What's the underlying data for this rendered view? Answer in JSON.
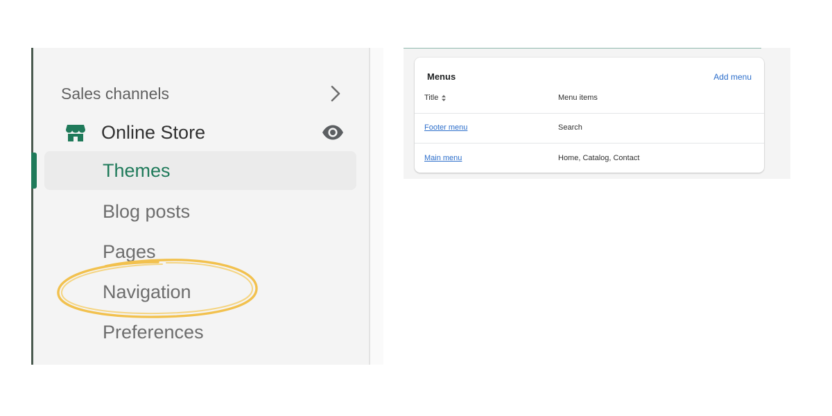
{
  "sidebar": {
    "section_label": "Sales channels",
    "store": {
      "label": "Online Store",
      "icon": "store-icon",
      "view_icon": "eye-icon"
    },
    "items": [
      {
        "label": "Themes",
        "active": true
      },
      {
        "label": "Blog posts",
        "active": false
      },
      {
        "label": "Pages",
        "active": false
      },
      {
        "label": "Navigation",
        "active": false,
        "highlighted": true
      },
      {
        "label": "Preferences",
        "active": false
      }
    ]
  },
  "menus_card": {
    "title": "Menus",
    "add_label": "Add menu",
    "columns": {
      "title": "Title",
      "items": "Menu items"
    },
    "rows": [
      {
        "title": "Footer menu",
        "items": "Search"
      },
      {
        "title": "Main menu",
        "items": "Home, Catalog, Contact"
      }
    ]
  },
  "colors": {
    "brand_green": "#1f7a5a",
    "link_blue": "#2c6ecb",
    "highlight_circle": "#f2c14e",
    "sidebar_bg": "#f4f4f4"
  }
}
